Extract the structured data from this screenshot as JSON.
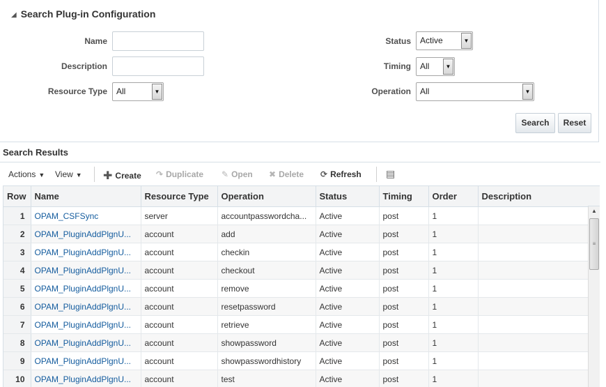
{
  "search": {
    "title": "Search Plug-in Configuration",
    "fields": {
      "name_label": "Name",
      "name_value": "",
      "description_label": "Description",
      "description_value": "",
      "resource_type_label": "Resource Type",
      "resource_type_value": "All",
      "status_label": "Status",
      "status_value": "Active",
      "timing_label": "Timing",
      "timing_value": "All",
      "operation_label": "Operation",
      "operation_value": "All"
    },
    "buttons": {
      "search": "Search",
      "reset": "Reset"
    }
  },
  "results": {
    "title": "Search Results",
    "toolbar": {
      "actions": "Actions",
      "view": "View",
      "create": "Create",
      "duplicate": "Duplicate",
      "open": "Open",
      "delete": "Delete",
      "refresh": "Refresh"
    },
    "columns": [
      "Row",
      "Name",
      "Resource Type",
      "Operation",
      "Status",
      "Timing",
      "Order",
      "Description"
    ],
    "rows": [
      {
        "row": "1",
        "name": "OPAM_CSFSync",
        "resource_type": "server",
        "operation": "accountpasswordcha...",
        "status": "Active",
        "timing": "post",
        "order": "1",
        "description": ""
      },
      {
        "row": "2",
        "name": "OPAM_PluginAddPlgnU...",
        "resource_type": "account",
        "operation": "add",
        "status": "Active",
        "timing": "post",
        "order": "1",
        "description": ""
      },
      {
        "row": "3",
        "name": "OPAM_PluginAddPlgnU...",
        "resource_type": "account",
        "operation": "checkin",
        "status": "Active",
        "timing": "post",
        "order": "1",
        "description": ""
      },
      {
        "row": "4",
        "name": "OPAM_PluginAddPlgnU...",
        "resource_type": "account",
        "operation": "checkout",
        "status": "Active",
        "timing": "post",
        "order": "1",
        "description": ""
      },
      {
        "row": "5",
        "name": "OPAM_PluginAddPlgnU...",
        "resource_type": "account",
        "operation": "remove",
        "status": "Active",
        "timing": "post",
        "order": "1",
        "description": ""
      },
      {
        "row": "6",
        "name": "OPAM_PluginAddPlgnU...",
        "resource_type": "account",
        "operation": "resetpassword",
        "status": "Active",
        "timing": "post",
        "order": "1",
        "description": ""
      },
      {
        "row": "7",
        "name": "OPAM_PluginAddPlgnU...",
        "resource_type": "account",
        "operation": "retrieve",
        "status": "Active",
        "timing": "post",
        "order": "1",
        "description": ""
      },
      {
        "row": "8",
        "name": "OPAM_PluginAddPlgnU...",
        "resource_type": "account",
        "operation": "showpassword",
        "status": "Active",
        "timing": "post",
        "order": "1",
        "description": ""
      },
      {
        "row": "9",
        "name": "OPAM_PluginAddPlgnU...",
        "resource_type": "account",
        "operation": "showpasswordhistory",
        "status": "Active",
        "timing": "post",
        "order": "1",
        "description": ""
      },
      {
        "row": "10",
        "name": "OPAM_PluginAddPlgnU...",
        "resource_type": "account",
        "operation": "test",
        "status": "Active",
        "timing": "post",
        "order": "1",
        "description": ""
      }
    ]
  },
  "colors": {
    "link": "#145c9e",
    "border": "#d6dfe6",
    "header_bg": "#f3f4f5"
  }
}
